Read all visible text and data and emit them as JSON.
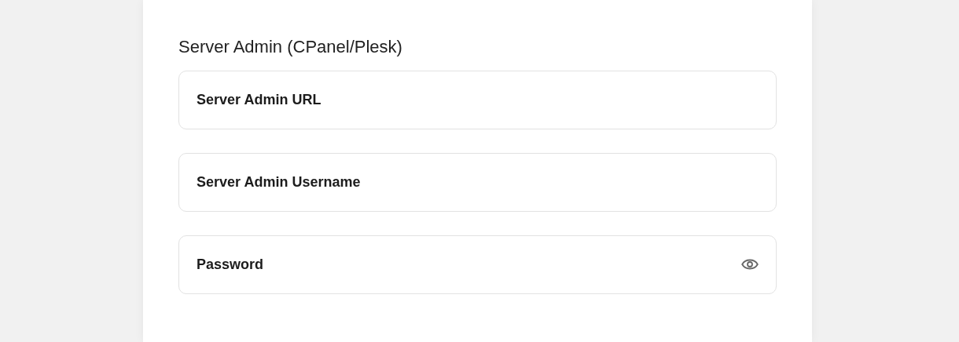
{
  "section": {
    "title": "Server Admin (CPanel/Plesk)"
  },
  "fields": [
    {
      "kind": "text",
      "placeholder": "Server Admin URL"
    },
    {
      "kind": "text",
      "placeholder": "Server Admin Username"
    },
    {
      "kind": "password",
      "placeholder": "Password"
    }
  ]
}
